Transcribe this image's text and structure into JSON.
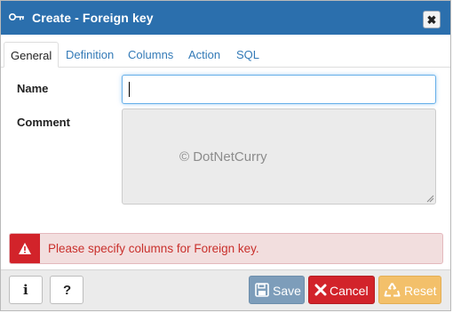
{
  "dialog": {
    "title": "Create - Foreign key",
    "close_symbol": "✖",
    "title_icon": "key-icon"
  },
  "tabs": [
    {
      "label": "General",
      "active": true
    },
    {
      "label": "Definition",
      "active": false
    },
    {
      "label": "Columns",
      "active": false
    },
    {
      "label": "Action",
      "active": false
    },
    {
      "label": "SQL",
      "active": false
    }
  ],
  "form": {
    "name_label": "Name",
    "name_value": "",
    "comment_label": "Comment",
    "comment_value": ""
  },
  "watermark": "© DotNetCurry",
  "error": {
    "message": "Please specify columns for Foreign key.",
    "icon": "warning-icon",
    "color": "#d2232a"
  },
  "footer": {
    "info_glyph": "i",
    "help_glyph": "?",
    "save_label": "Save",
    "cancel_label": "Cancel",
    "reset_label": "Reset"
  },
  "colors": {
    "titlebar": "#2b6fad",
    "link": "#337ab7",
    "save": "#7d9dba",
    "cancel": "#d2232a",
    "reset": "#f3c06a"
  }
}
